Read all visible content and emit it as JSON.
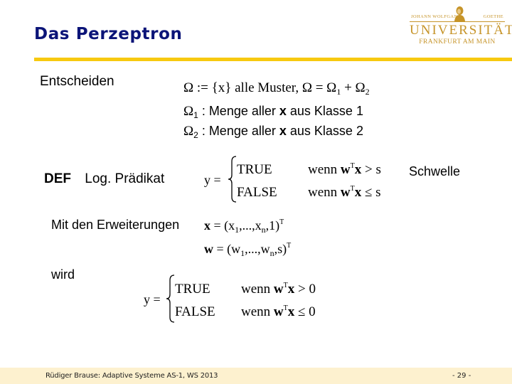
{
  "slide": {
    "title": "Das Perzeptron",
    "logo": {
      "top_left": "JOHANN WOLFGANG",
      "top_right": "GOETHE",
      "name": "UNIVERSITÄT",
      "city": "FRANKFURT AM MAIN"
    },
    "section_label": "Entscheiden",
    "omega_def": {
      "omega": "Ω",
      "assign": " := {x} alle Muster, Ω = Ω",
      "sub1": "1",
      "plus": " + Ω",
      "sub2": "2"
    },
    "omega_lines": [
      {
        "omega": "Ω",
        "sub": "1",
        "text": " :  Menge aller ",
        "bold": "x",
        "rest": " aus Klasse 1"
      },
      {
        "omega": "Ω",
        "sub": "2",
        "text": " :  Menge aller ",
        "bold": "x",
        "rest": " aus Klasse 2"
      }
    ],
    "def_label": "DEF",
    "def_title": "Log. Prädikat",
    "predicate_1": {
      "lhs": "y =",
      "case_true": "TRUE",
      "case_false": "FALSE",
      "cond_true_prefix": "wenn ",
      "cond_w": "w",
      "cond_T": "T",
      "cond_x": "x",
      "cond_true_rel": " > s",
      "cond_false_rel": " ≤ s"
    },
    "threshold_label": "Schwelle",
    "extension_label": "Mit den Erweiterungen",
    "x_ext": {
      "lhs": "x",
      "eq": " = (x",
      "s1": "1",
      "mid": ",...,x",
      "sn": "n",
      "end": ",1)",
      "T": "T"
    },
    "w_ext": {
      "lhs": "w",
      "eq": " = (w",
      "s1": "1",
      "mid": ",...,w",
      "sn": "n",
      "end": ",s)",
      "T": "T"
    },
    "becomes_label": "wird",
    "predicate_2": {
      "lhs": "y =",
      "case_true": "TRUE",
      "case_false": "FALSE",
      "cond_true_prefix": "wenn ",
      "cond_w": "w",
      "cond_T": "T",
      "cond_x": "x",
      "cond_true_rel": " > 0",
      "cond_false_rel": " ≤ 0"
    },
    "footer": {
      "left": "Rüdiger Brause: Adaptive Systeme AS-1, WS 2013",
      "page": "- 29 -"
    },
    "colors": {
      "title": "#0b1478",
      "rule": "#f7c910",
      "logo": "#c69429",
      "footer_bg": "#fdf1cf"
    }
  }
}
